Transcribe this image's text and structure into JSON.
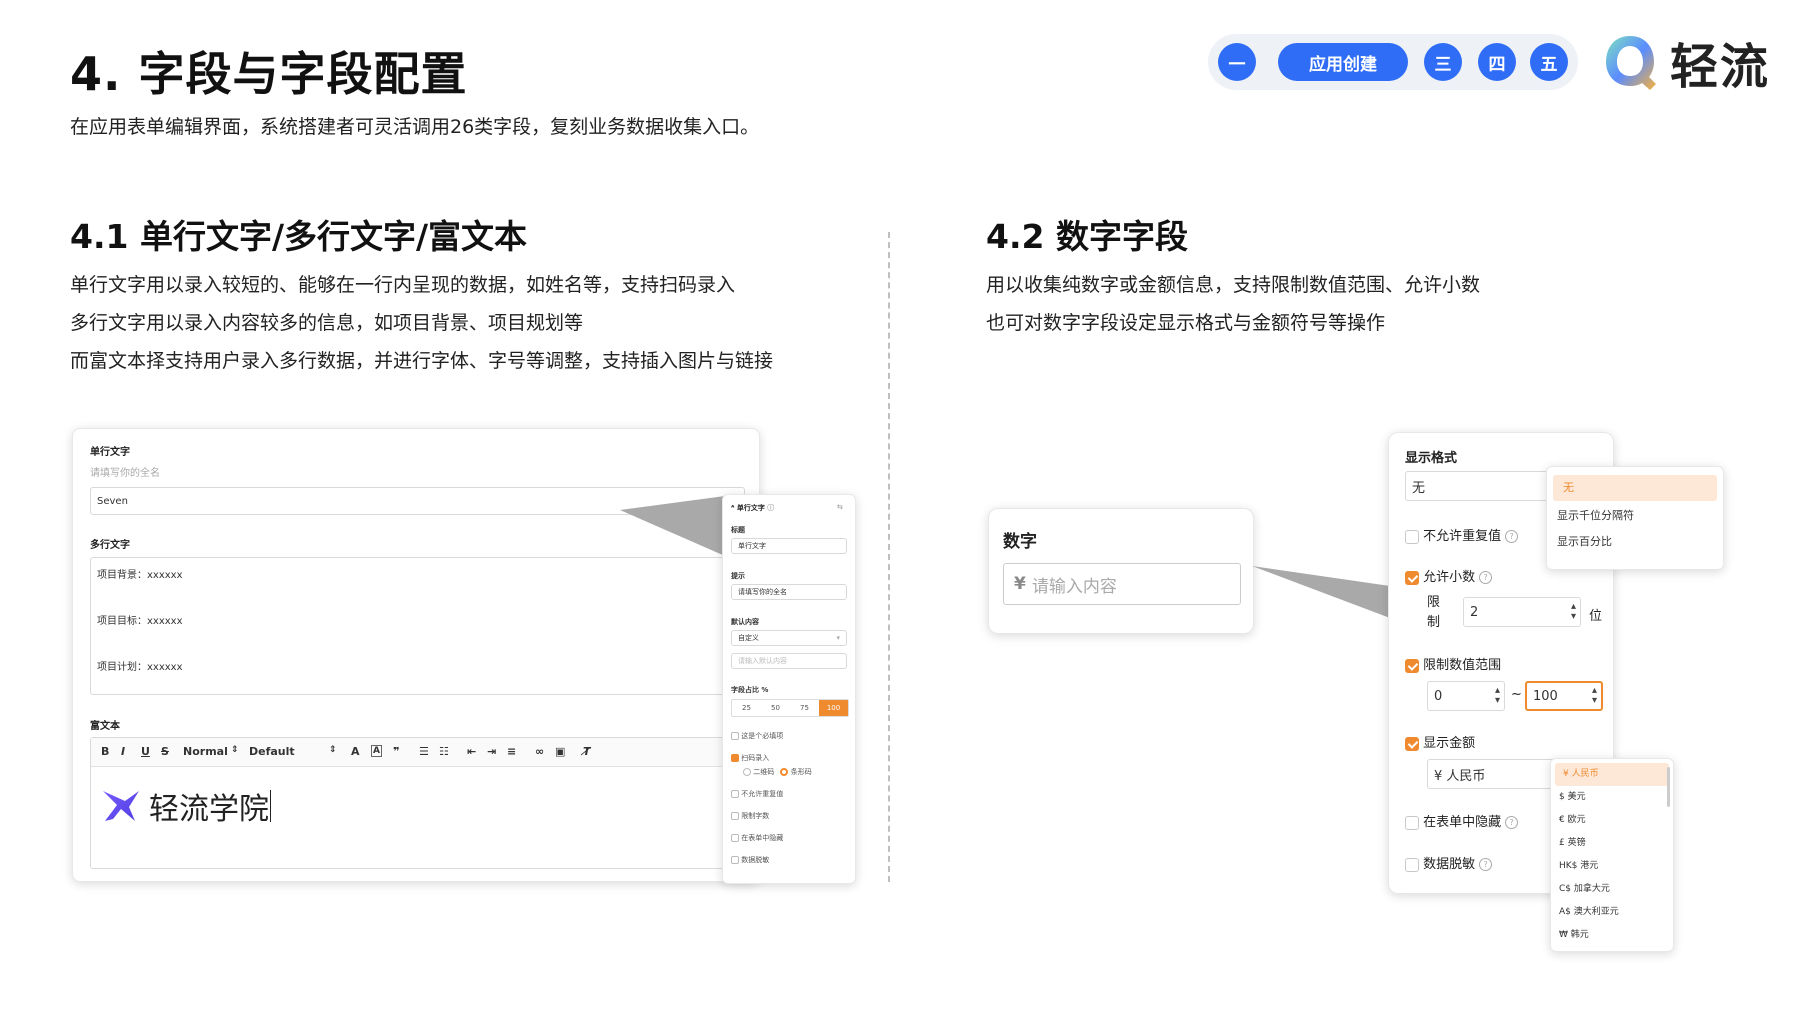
{
  "header": {
    "title": "4. 字段与字段配置",
    "subtitle": "在应用表单编辑界面，系统搭建者可灵活调用26类字段，复刻业务数据收集入口。",
    "nav": [
      "一",
      "应用创建",
      "三",
      "四",
      "五"
    ],
    "logo_text": "轻流",
    "accent_color": "#2f6df6"
  },
  "section1": {
    "title": "4.1 单行文字/多行文字/富文本",
    "lines": [
      "单行文字用以录入较短的、能够在一行内呈现的数据，如姓名等，支持扫码录入",
      "多行文字用以录入内容较多的信息，如项目背景、项目规划等",
      "而富文本择支持用户录入多行数据，并进行字体、字号等调整，支持插入图片与链接"
    ],
    "form": {
      "single_label": "单行文字",
      "single_hint": "请填写你的全名",
      "single_value": "Seven",
      "multi_label": "多行文字",
      "multi_lines": [
        "项目背景：xxxxxx",
        "项目目标：xxxxxx",
        "项目计划：xxxxxx"
      ],
      "rich_label": "富文本",
      "toolbar": [
        "B",
        "I",
        "U",
        "S",
        "Normal",
        "Default"
      ],
      "rich_content": "轻流学院"
    },
    "config": {
      "header": "单行文字",
      "title_label": "标题",
      "title_value": "单行文字",
      "hint_label": "提示",
      "hint_value": "请填写你的全名",
      "default_label": "默认内容",
      "default_select": "自定义",
      "default_placeholder": "请输入默认内容",
      "width_label": "字段占比 %",
      "width_options": [
        "25",
        "50",
        "75",
        "100"
      ],
      "width_selected": "100",
      "options": [
        {
          "label": "这是个必填项",
          "checked": false
        },
        {
          "label": "扫码录入",
          "checked": true
        },
        {
          "label": "不允许重复值",
          "checked": false
        },
        {
          "label": "限制字数",
          "checked": false
        },
        {
          "label": "在表单中隐藏",
          "checked": false
        },
        {
          "label": "数据脱敏",
          "checked": false
        }
      ],
      "scan_options": [
        "二维码",
        "条形码"
      ]
    }
  },
  "section2": {
    "title": "4.2 数字字段",
    "lines": [
      "用以收集纯数字或金额信息，支持限制数值范围、允许小数",
      "也可对数字字段设定显示格式与金额符号等操作"
    ],
    "number_card": {
      "label": "数字",
      "currency_symbol": "¥",
      "placeholder": "请输入内容"
    },
    "config": {
      "format_label": "显示格式",
      "format_value": "无",
      "format_options": [
        "无",
        "显示千位分隔符",
        "显示百分比"
      ],
      "no_repeat": "不允许重复值",
      "allow_decimal": "允许小数",
      "limit_label": "限制",
      "limit_value": "2",
      "limit_unit": "位",
      "range_label": "限制数值范围",
      "range_min": "0",
      "range_sep": "~",
      "range_max": "100",
      "show_amount": "显示金额",
      "currency_value": "¥ 人民币",
      "hide_in_form": "在表单中隐藏",
      "masking": "数据脱敏"
    },
    "currencies": [
      "¥ 人民币",
      "$ 美元",
      "€ 欧元",
      "£ 英镑",
      "HK$ 港元",
      "C$ 加拿大元",
      "A$ 澳大利亚元",
      "₩ 韩元"
    ],
    "highlight_color": "#ef8a2e"
  }
}
